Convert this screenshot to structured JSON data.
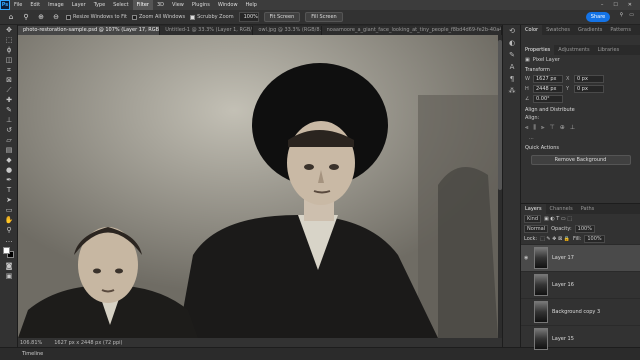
{
  "menubar": {
    "logo": "Ps",
    "items": [
      "File",
      "Edit",
      "Image",
      "Layer",
      "Type",
      "Select",
      "Filter",
      "3D",
      "View",
      "Plugins",
      "Window",
      "Help"
    ],
    "active_index": 6
  },
  "options": {
    "resize_windows": "Resize Windows to Fit",
    "zoom_all": "Zoom All Windows",
    "scrubby_zoom": "Scrubby Zoom",
    "zoom_value": "100%",
    "fit_screen": "Fit Screen",
    "fill_screen": "Fill Screen",
    "share": "Share"
  },
  "tabs": [
    {
      "label": "photo-restoration-sample.psd @ 107% (Layer 17, RGB/8#) *",
      "active": true
    },
    {
      "label": "Untitled-1 @ 33.3% (Layer 1, RGB/8...",
      "active": false
    },
    {
      "label": "owl.jpg @ 33.3% (RGB/8...",
      "active": false
    },
    {
      "label": "noaamoore_a_giant_face_looking_at_tiny_people_f8bd4d69-fe2b-40a4-8529...",
      "active": false
    }
  ],
  "status": {
    "zoom": "106.81%",
    "dimensions": "1627 px x 2448 px (72 ppi)"
  },
  "timeline_label": "Timeline",
  "panels": {
    "top_tabs": [
      "Color",
      "Swatches",
      "Gradients",
      "Patterns"
    ],
    "prop_tabs": [
      "Properties",
      "Adjustments",
      "Libraries"
    ],
    "pixel_layer": "Pixel Layer",
    "transform_title": "Transform",
    "w_label": "W",
    "h_label": "H",
    "x_label": "X",
    "y_label": "Y",
    "w_value": "1627 px",
    "h_value": "2448 px",
    "x_value": "0 px",
    "y_value": "0 px",
    "angle_value": "0.00°",
    "align_title": "Align and Distribute",
    "align_sub": "Align:",
    "quick_actions": "Quick Actions",
    "remove_bg": "Remove Background",
    "more": "..."
  },
  "layers": {
    "tabs": [
      "Layers",
      "Channels",
      "Paths"
    ],
    "kind": "Kind",
    "blend_mode": "Normal",
    "opacity_label": "Opacity:",
    "opacity_value": "100%",
    "lock_label": "Lock:",
    "fill_label": "Fill:",
    "fill_value": "100%",
    "items": [
      {
        "name": "Layer 17",
        "selected": true
      },
      {
        "name": "Layer 16",
        "selected": false
      },
      {
        "name": "Background copy 3",
        "selected": false
      },
      {
        "name": "Layer 15",
        "selected": false
      }
    ]
  }
}
